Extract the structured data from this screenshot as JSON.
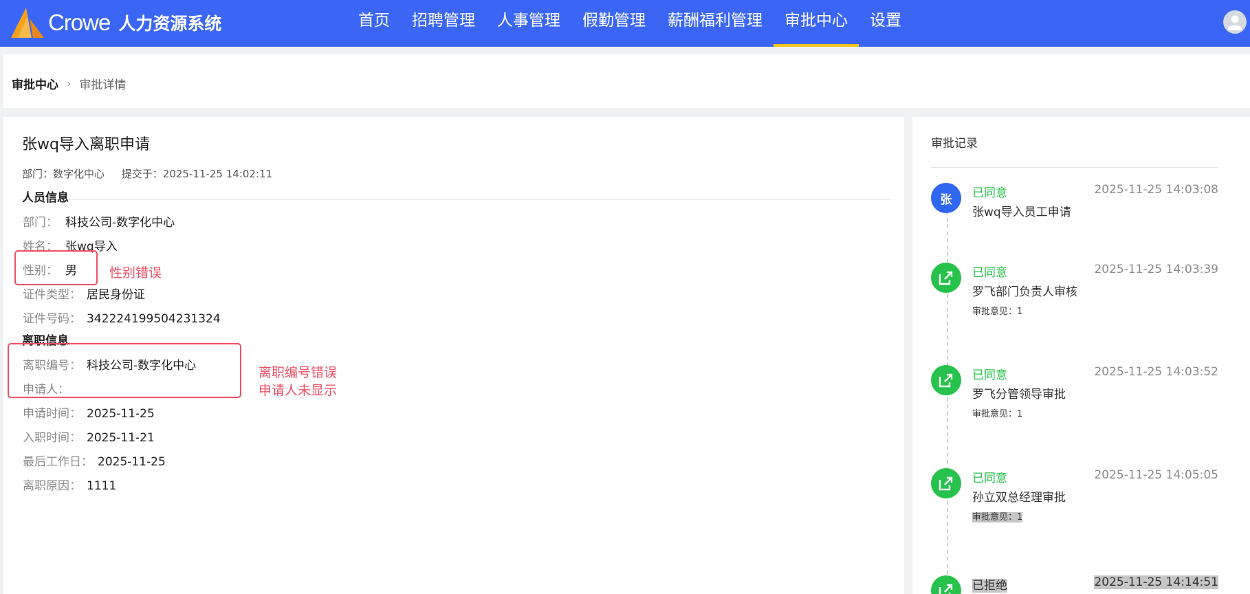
{
  "header": {
    "brand": "Crowe",
    "system_name": "人力资源系统",
    "nav": [
      {
        "label": "首页"
      },
      {
        "label": "招聘管理"
      },
      {
        "label": "人事管理"
      },
      {
        "label": "假勤管理"
      },
      {
        "label": "薪酬福利管理"
      },
      {
        "label": "审批中心",
        "active": true
      },
      {
        "label": "设置"
      }
    ],
    "colors": {
      "bar": "#3b66f5",
      "active_underline": "#f4c21a"
    }
  },
  "breadcrumb": {
    "root": "审批中心",
    "current": "审批详情"
  },
  "detail": {
    "title": "张wq导入离职申请",
    "department_meta": "部门：数字化中心",
    "submitted_meta": "提交于：2025-11-25 14:02:11",
    "personnel": {
      "heading": "人员信息",
      "department": {
        "label": "部门：",
        "value": "科技公司-数字化中心"
      },
      "name": {
        "label": "姓名：",
        "value": "张wq导入"
      },
      "gender": {
        "label": "性别：",
        "value": "男"
      },
      "id_type": {
        "label": "证件类型：",
        "value": "居民身份证"
      },
      "id_number": {
        "label": "证件号码：",
        "value": "342224199504231324"
      }
    },
    "resignation": {
      "heading": "离职信息",
      "number": {
        "label": "离职编号：",
        "value": "科技公司-数字化中心"
      },
      "applicant": {
        "label": "申请人：",
        "value": ""
      },
      "apply_date": {
        "label": "申请时间：",
        "value": "2025-11-25"
      },
      "entry_date": {
        "label": "入职时间：",
        "value": "2025-11-21"
      },
      "last_day": {
        "label": "最后工作日：",
        "value": "2025-11-25"
      },
      "reason": {
        "label": "离职原因：",
        "value": "1111"
      }
    },
    "annotations": {
      "gender_error": "性别错误",
      "number_error": "离职编号错误",
      "applicant_missing": "申请人未显示"
    }
  },
  "approval": {
    "title": "审批记录",
    "records": [
      {
        "avatar": "张",
        "status": "已同意",
        "time": "2025-11-25 14:03:08",
        "name": "张wq导入员工申请",
        "opinion": ""
      },
      {
        "status": "已同意",
        "time": "2025-11-25 14:03:39",
        "name": "罗飞部门负责人审核",
        "opinion": "审批意见：1"
      },
      {
        "status": "已同意",
        "time": "2025-11-25 14:03:52",
        "name": "罗飞分管领导审批",
        "opinion": "审批意见：1"
      },
      {
        "status": "已同意",
        "time": "2025-11-25 14:05:05",
        "name": "孙立双总经理审批",
        "opinion": "审批意见：1"
      },
      {
        "status": "已拒绝",
        "time": "2025-11-25 14:14:51"
      }
    ]
  }
}
